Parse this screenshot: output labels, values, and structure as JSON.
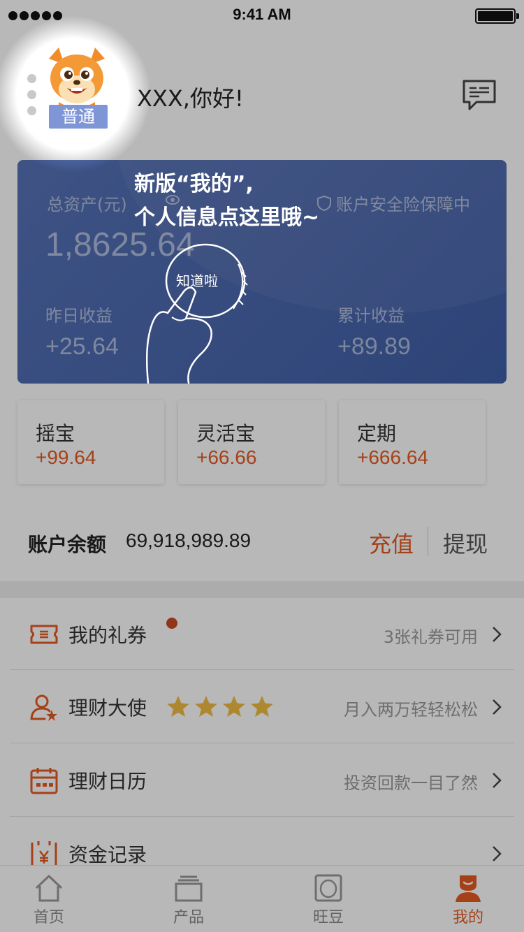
{
  "status_bar": {
    "time": "9:41 AM"
  },
  "header": {
    "level_badge": "普通",
    "greeting": "XXX,你好!"
  },
  "asset_card": {
    "total_label": "总资产(元)",
    "total_value": "1,8625.64",
    "security_text": "账户安全险保障中",
    "yesterday_label": "昨日收益",
    "yesterday_value": "+25.64",
    "cumulative_label": "累计收益",
    "cumulative_value": "+89.89"
  },
  "products": [
    {
      "name": "摇宝",
      "value": "+99.64"
    },
    {
      "name": "灵活宝",
      "value": "+66.66"
    },
    {
      "name": "定期",
      "value": "+666.64"
    }
  ],
  "balance": {
    "label": "账户余额",
    "value": "69,918,989.89",
    "recharge_label": "充值",
    "withdraw_label": "提现"
  },
  "menu": [
    {
      "label": "我的礼券",
      "hint": "3张礼券可用",
      "icon": "coupon-icon"
    },
    {
      "label": "理财大使",
      "hint": "月入两万轻轻松松",
      "icon": "ambassador-icon",
      "stars": 4
    },
    {
      "label": "理财日历",
      "hint": "投资回款一目了然",
      "icon": "calendar-icon"
    },
    {
      "label": "资金记录",
      "hint": "",
      "icon": "fund-record-icon"
    }
  ],
  "tabs": [
    {
      "label": "首页",
      "icon": "home-icon"
    },
    {
      "label": "产品",
      "icon": "product-icon"
    },
    {
      "label": "旺豆",
      "icon": "bean-icon"
    },
    {
      "label": "我的",
      "icon": "mine-icon",
      "active": true
    }
  ],
  "guide": {
    "line1": "新版“我的”,",
    "line2": "个人信息点这里哦~",
    "button_text": "知道啦"
  },
  "colors": {
    "accent": "#e55a21",
    "card": "#4a67ad",
    "badge": "#7e95d6"
  }
}
